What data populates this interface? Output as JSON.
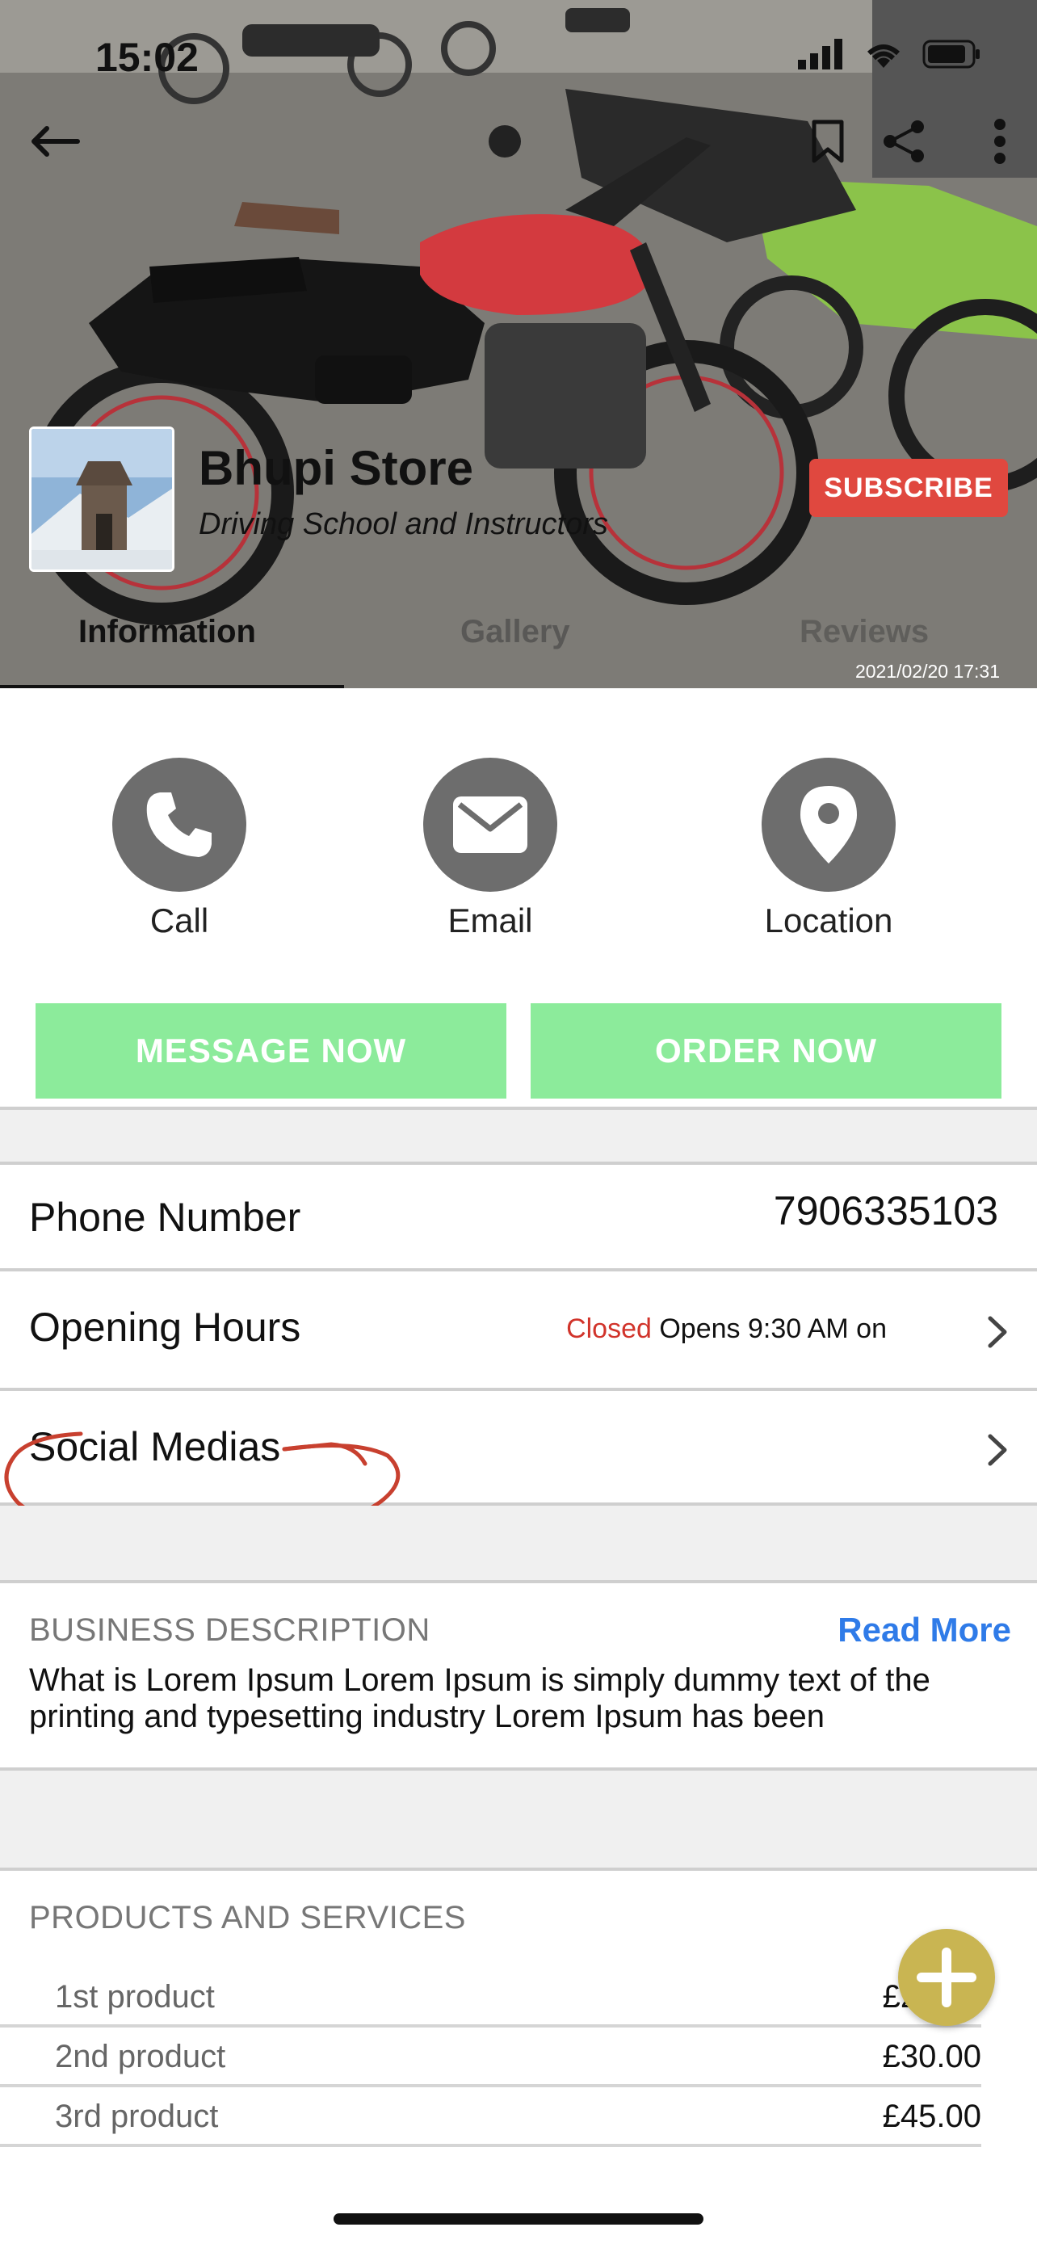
{
  "status_bar": {
    "time": "15:02"
  },
  "hero": {
    "store_name": "Bhupi Store",
    "category": "Driving School and Instructors",
    "subscribe_label": "SUBSCRIBE",
    "timestamp": "2021/02/20 17:31",
    "tabs": [
      {
        "label": "Information",
        "active": true
      },
      {
        "label": "Gallery",
        "active": false
      },
      {
        "label": "Reviews",
        "active": false
      }
    ]
  },
  "actions": {
    "call": "Call",
    "email": "Email",
    "location": "Location"
  },
  "buttons": {
    "message_now": "MESSAGE NOW",
    "order_now": "ORDER NOW"
  },
  "info": {
    "phone_label": "Phone Number",
    "phone_value": "7906335103",
    "hours_label": "Opening Hours",
    "hours_status": "Closed",
    "hours_detail": "Opens 9:30 AM on",
    "social_label": "Social Medias"
  },
  "description": {
    "title": "BUSINESS DESCRIPTION",
    "read_more": "Read More",
    "text": "What is Lorem Ipsum Lorem Ipsum is simply dummy text of the printing and typesetting industry Lorem Ipsum has been"
  },
  "products": {
    "title": "PRODUCTS AND SERVICES",
    "items": [
      {
        "name": "1st product",
        "price": "£20.00"
      },
      {
        "name": "2nd product",
        "price": "£30.00"
      },
      {
        "name": "3rd product",
        "price": "£45.00"
      }
    ]
  },
  "colors": {
    "subscribe": "#e0483f",
    "green_button": "#8ceb9b",
    "closed": "#d1342b",
    "read_more": "#2f7be8",
    "fab": "#c9b552",
    "annotation": "#c8402f"
  }
}
